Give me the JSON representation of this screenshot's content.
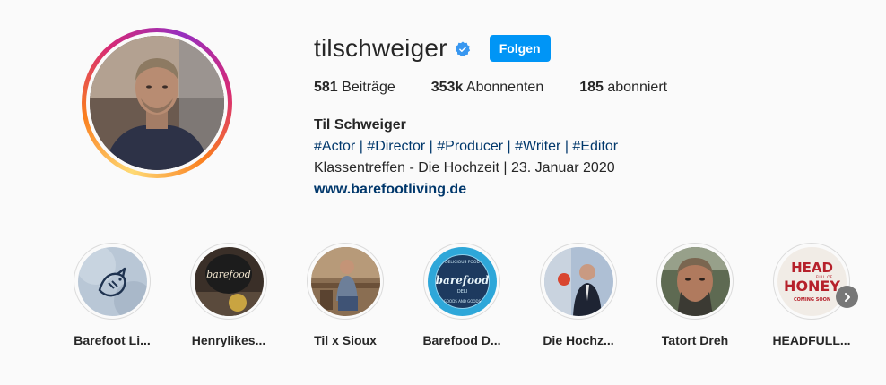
{
  "profile": {
    "username": "tilschweiger",
    "follow_label": "Folgen",
    "stats": {
      "posts_count": "581",
      "posts_label": "Beiträge",
      "followers_count": "353k",
      "followers_label": "Abonnenten",
      "following_count": "185",
      "following_label": "abonniert"
    },
    "full_name": "Til Schweiger",
    "bio_tags": "#Actor | #Director | #Producer | #Writer | #Editor",
    "bio_line": "Klassentreffen - Die Hochzeit | 23. Januar 2020",
    "website": "www.barefootliving.de"
  },
  "highlights": [
    {
      "label": "Barefoot Li..."
    },
    {
      "label": "Henrylikes..."
    },
    {
      "label": "Til x Sioux"
    },
    {
      "label": "Barefood D..."
    },
    {
      "label": "Die Hochz..."
    },
    {
      "label": "Tatort Dreh"
    },
    {
      "label": "HEADFULL..."
    }
  ],
  "highlight_art": {
    "barefood_top": "DELICIOUS FOOD",
    "barefood_word": "barefood",
    "barefood_deli": "DELI",
    "barefood_bottom": "GOODS AND GOODS",
    "head_line1": "HEAD",
    "head_line2": "FULL OF",
    "head_line3": "HONEY",
    "head_line4": "COMING SOON"
  },
  "colors": {
    "accent": "#0095f6",
    "link": "#00376b",
    "text": "#262626",
    "background": "#fafafa"
  },
  "icons": {
    "verified": "verified-badge-icon",
    "next": "chevron-right-icon"
  }
}
